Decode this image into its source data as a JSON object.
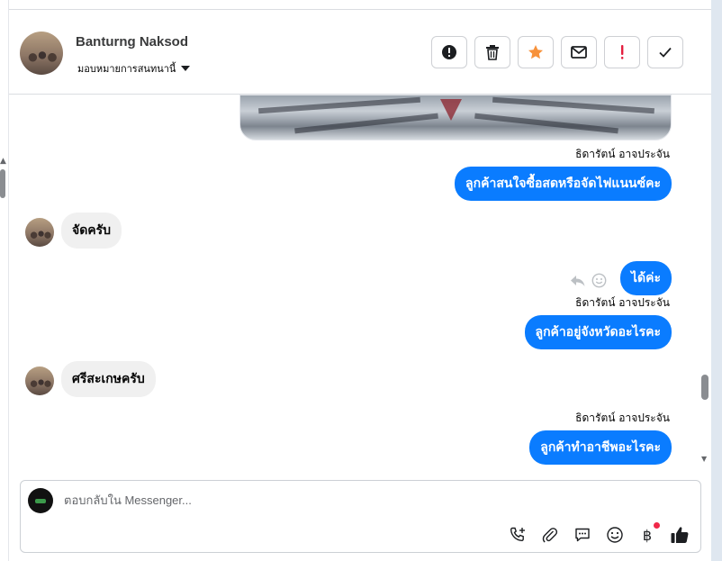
{
  "header": {
    "contact_name": "Banturng Naksod",
    "assign_label": "มอบหมายการสนทนานี้",
    "actions": [
      {
        "name": "report-button",
        "icon": "alert-circle-icon"
      },
      {
        "name": "delete-button",
        "icon": "trash-icon"
      },
      {
        "name": "star-button",
        "icon": "star-icon"
      },
      {
        "name": "mark-unread-button",
        "icon": "envelope-icon"
      },
      {
        "name": "spam-button",
        "icon": "exclamation-icon"
      },
      {
        "name": "mark-done-button",
        "icon": "check-icon"
      }
    ]
  },
  "messages": [
    {
      "sender": "ธิดารัตน์ อาจประจัน",
      "text": "ลูกค้าสนใจซื้อสดหรือจัดไฟแนนซ์คะ",
      "direction": "out"
    },
    {
      "text": "จัดครับ",
      "direction": "in"
    },
    {
      "text": "ได้ค่ะ",
      "direction": "out"
    },
    {
      "sender": "ธิดารัตน์ อาจประจัน",
      "text": "ลูกค้าอยู่จังหวัดอะไรคะ",
      "direction": "out"
    },
    {
      "text": "ศรีสะเกษครับ",
      "direction": "in"
    },
    {
      "sender": "ธิดารัตน์ อาจประจัน",
      "text": "ลูกค้าทำอาชีพอะไรคะ",
      "direction": "out"
    }
  ],
  "composer": {
    "placeholder": "ตอบกลับใน Messenger...",
    "value": "",
    "baht_symbol": "฿"
  },
  "colors": {
    "outgoing_bubble": "#0a7cff",
    "incoming_bubble": "#f0f0f0",
    "star_active": "#f7923b",
    "spam_red": "#e41e3f",
    "notification_dot": "#f02849"
  }
}
